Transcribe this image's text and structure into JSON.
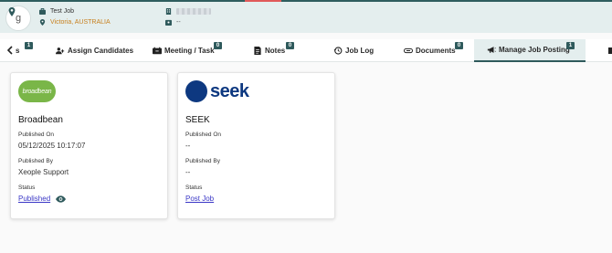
{
  "header": {
    "job_title": "Test Job",
    "location": "Victoria, AUSTRALIA",
    "field2_value": "--"
  },
  "tabs": [
    {
      "label": "s",
      "badge": "1"
    },
    {
      "label": "Assign Candidates",
      "badge": ""
    },
    {
      "label": "Meeting / Task",
      "badge": "0"
    },
    {
      "label": "Notes",
      "badge": "0"
    },
    {
      "label": "Job Log",
      "badge": ""
    },
    {
      "label": "Documents",
      "badge": "0"
    },
    {
      "label": "Manage Job Posting",
      "badge": "1"
    }
  ],
  "cards": [
    {
      "logo_text": "broadbean",
      "name": "Broadbean",
      "published_on_label": "Published On",
      "published_on": "05/12/2025 10:17:07",
      "published_by_label": "Published By",
      "published_by": "Xeople Support",
      "status_label": "Status",
      "status": "Published"
    },
    {
      "logo_text": "seek",
      "name": "SEEK",
      "published_on_label": "Published On",
      "published_on": "--",
      "published_by_label": "Published By",
      "published_by": "--",
      "status_label": "Status",
      "status": "Post Job"
    }
  ],
  "colors": {
    "accent": "#2f5a5c",
    "header_bg": "#e4eeee",
    "location": "#c7801f",
    "link": "#3a37c6",
    "broadbean_green": "#7ab648",
    "seek_blue": "#0d3880"
  },
  "icons": [
    "chevron-left-icon",
    "briefcase-icon",
    "location-icon",
    "building-icon",
    "contact-icon",
    "assign-candidates-icon",
    "meeting-icon",
    "notes-icon",
    "history-icon",
    "documents-icon",
    "megaphone-icon",
    "eye-icon"
  ]
}
